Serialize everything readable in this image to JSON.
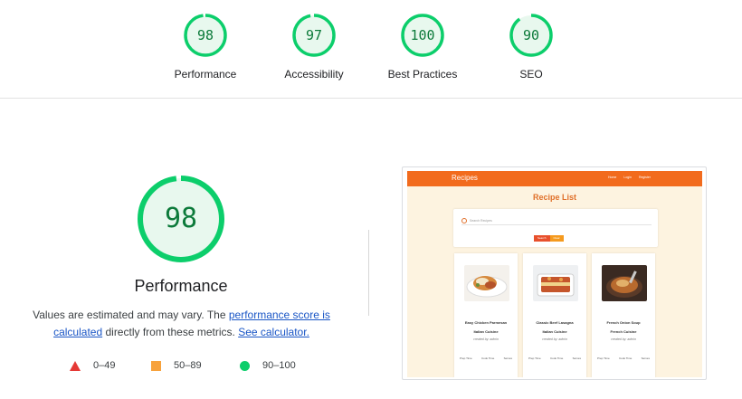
{
  "colors": {
    "pass": "#0cce6b",
    "pass_text": "#0c7a3a",
    "pass_fill": "#e8f8ee",
    "average": "#f7a23c",
    "fail": "#e53935",
    "link": "#1a56c6",
    "thumb_nav": "#f26b1d"
  },
  "categories": [
    {
      "label": "Performance",
      "score": "98"
    },
    {
      "label": "Accessibility",
      "score": "97"
    },
    {
      "label": "Best Practices",
      "score": "100"
    },
    {
      "label": "SEO",
      "score": "90"
    }
  ],
  "main": {
    "score": "98",
    "title": "Performance",
    "desc_pre": "Values are estimated and may vary. The ",
    "desc_link1": "performance score is calculated",
    "desc_mid": " directly from these metrics. ",
    "desc_link2": "See calculator."
  },
  "legend": [
    {
      "label": "0–49",
      "icon": "triangle-icon"
    },
    {
      "label": "50–89",
      "icon": "square-icon"
    },
    {
      "label": "90–100",
      "icon": "circle-icon"
    }
  ],
  "thumbnail": {
    "brand": "Recipes",
    "nav_links": [
      "Home",
      "Login",
      "Register"
    ],
    "heading": "Recipe List",
    "search_placeholder": "Search Recipes",
    "btn_search": "Search",
    "btn_clear": "Clear",
    "cards": [
      {
        "title": "Easy Chicken Parmesan",
        "cuisine": "Italian Cuisine",
        "author": "created by: admin",
        "meta": [
          "Prep Time",
          "Cook Time",
          "Serves"
        ]
      },
      {
        "title": "Classic Beef Lasagna",
        "cuisine": "Italian Cuisine",
        "author": "created by: admin",
        "meta": [
          "Prep Time",
          "Cook Time",
          "Serves"
        ]
      },
      {
        "title": "French Onion Soup",
        "cuisine": "French Cuisine",
        "author": "created by: admin",
        "meta": [
          "Prep Time",
          "Cook Time",
          "Serves"
        ]
      }
    ]
  }
}
